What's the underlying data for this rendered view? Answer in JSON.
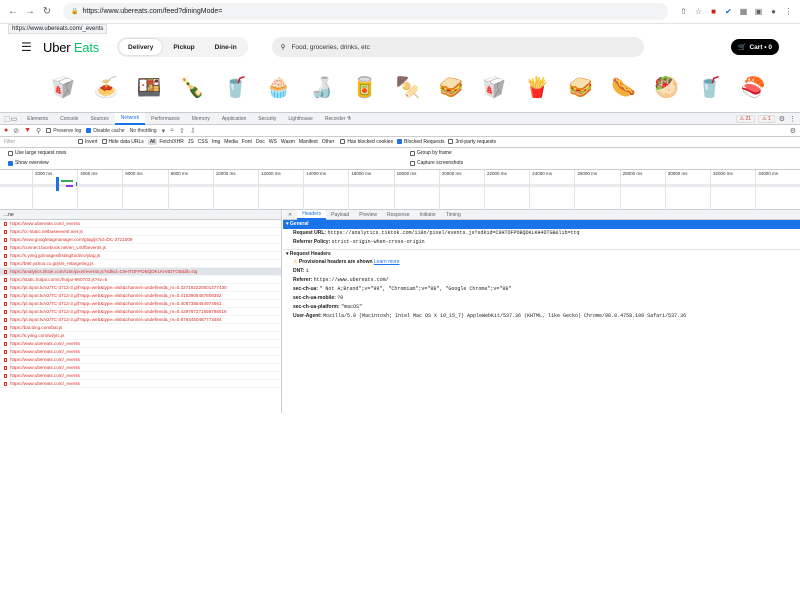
{
  "browser": {
    "url": "https://www.ubereats.com/feed?diningMode=",
    "status_url": "https://www.ubereats.com/_events"
  },
  "uber": {
    "logo_part1": "Uber",
    "logo_part2": "Eats",
    "modes": [
      "Delivery",
      "Pickup",
      "Dine-in"
    ],
    "search_placeholder": "Food, groceries, drinks, etc",
    "cart": "Cart • 0"
  },
  "categories": [
    "🥡",
    "🍝",
    "🍱",
    "🍾",
    "🥤",
    "🧁",
    "🍶",
    "🥫",
    "🍢",
    "🥪",
    "🥡",
    "🍟",
    "🥪",
    "🌭",
    "🥙",
    "🥤",
    "🍣"
  ],
  "devtools": {
    "tabs": [
      "Elements",
      "Console",
      "Sources",
      "Network",
      "Performance",
      "Memory",
      "Application",
      "Security",
      "Lighthouse",
      "Recorder ⚗"
    ],
    "errors": "21",
    "warnings": "1",
    "toolbar": {
      "preserve_log": "Preserve log",
      "disable_cache": "Disable cache",
      "throttling": "No throttling"
    },
    "filter": {
      "placeholder": "Filter",
      "invert": "Invert",
      "hide_data_urls": "Hide data URLs",
      "types": [
        "All",
        "Fetch/XHR",
        "JS",
        "CSS",
        "Img",
        "Media",
        "Font",
        "Doc",
        "WS",
        "Wasm",
        "Manifest",
        "Other"
      ],
      "blocked_cookies": "Has blocked cookies",
      "blocked_requests": "Blocked Requests",
      "third_party": "3rd-party requests"
    },
    "options": {
      "large_rows": "Use large request rows",
      "show_overview": "Show overview",
      "group_frame": "Group by frame",
      "capture_screenshots": "Capture screenshots"
    },
    "timeline_ticks": [
      "2000 ms",
      "4000 ms",
      "6000 ms",
      "8000 ms",
      "10000 ms",
      "12000 ms",
      "14000 ms",
      "16000 ms",
      "18000 ms",
      "20000 ms",
      "22000 ms",
      "24000 ms",
      "26000 ms",
      "28000 ms",
      "30000 ms",
      "32000 ms",
      "34000 ms",
      "36"
    ],
    "name_header": "...ne",
    "requests": [
      "https://www.ubereats.com/_events",
      "https://cc-static.netbaseevent.nier.js",
      "https://www.googletagmanager.com/gtag/js?id=DC-3721009",
      "https://connect.facebook.net/en_US/fbevents.js",
      "https://s.yimg.jp/images/listing/tool/cv/ytag.js",
      "https://b90.yahoo.co.jp/js/s_retargeting.js",
      "https://analytics.tiktok.com/i18n/pixel/events.js?sdkid=C9HTOFPOBQDKLKH4DTGB&lib=ttq",
      "https://static.hotjar.com/c/hotjar-960703.js?sv=6",
      "https://pt.ispot.tv/v2/TC-3713-3.gif?app=web&type=visit&channel=undefined&_m=0.327192220001477430",
      "https://pt.ispot.tv/v2/TC-3713-3.gif?app=web&type=visit&channel=undefined&_m=0.4153905487809392",
      "https://pt.ispot.tv/v2/TC-3713-3.gif?app=web&type=visit&channel=undefined&_m=0.4067385464974661",
      "https://pt.ispot.tv/v2/TC-3713-3.gif?app=web&type=visit&channel=undefined&_m=0.429797271659798016",
      "https://pt.ispot.tv/v2/TC-3713-3.gif?app=web&type=visit&channel=undefined&_m=0.8793450487773484",
      "https://bat.bing.com/bat.js",
      "https://s.yimg.com/wi/ytc.js",
      "https://www.ubereats.com/_events",
      "https://www.ubereats.com/_events",
      "https://www.ubereats.com/_events",
      "https://www.ubereats.com/_events",
      "https://www.ubereats.com/_events",
      "https://www.ubereats.com/_events"
    ],
    "selected_index": 6,
    "detail_tabs": [
      "Headers",
      "Payload",
      "Preview",
      "Response",
      "Initiator",
      "Timing"
    ],
    "general_label": "General",
    "general": [
      {
        "k": "Request URL:",
        "v": "https://analytics.tiktok.com/i18n/pixel/events.js?sdkid=C9HTOFPOBQDKLKH4DTGB&lib=ttq"
      },
      {
        "k": "Referrer Policy:",
        "v": "strict-origin-when-cross-origin"
      }
    ],
    "request_headers_label": "Request Headers",
    "provisional": "Provisional headers are shown",
    "learn_more": "Learn more",
    "request_headers": [
      {
        "k": "DNT:",
        "v": "1"
      },
      {
        "k": "Referer:",
        "v": "https://www.ubereats.com/"
      },
      {
        "k": "sec-ch-ua:",
        "v": "\" Not A;Brand\";v=\"99\", \"Chromium\";v=\"98\", \"Google Chrome\";v=\"98\""
      },
      {
        "k": "sec-ch-ua-mobile:",
        "v": "?0"
      },
      {
        "k": "sec-ch-ua-platform:",
        "v": "\"macOS\""
      },
      {
        "k": "User-Agent:",
        "v": "Mozilla/5.0 (Macintosh; Intel Mac OS X 10_15_7) AppleWebKit/537.36 (KHTML, like Gecko) Chrome/98.0.4758.109 Safari/537.36"
      }
    ]
  }
}
